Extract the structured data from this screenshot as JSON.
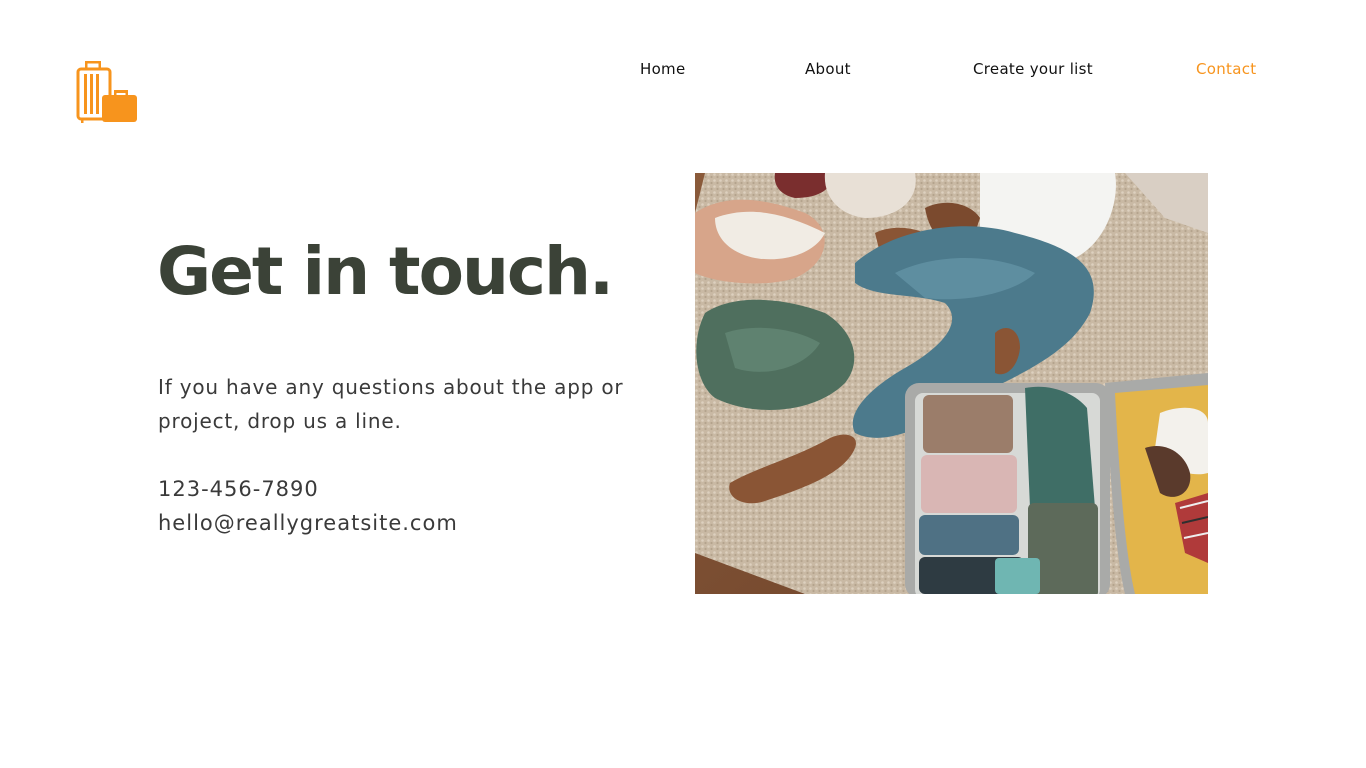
{
  "brand": {
    "logo_icon": "luggage-icon",
    "accent_color": "#F7941D"
  },
  "nav": {
    "items": [
      {
        "label": "Home",
        "active": false
      },
      {
        "label": "About",
        "active": false
      },
      {
        "label": "Create your list",
        "active": false
      },
      {
        "label": "Contact",
        "active": true
      }
    ]
  },
  "hero": {
    "title": "Get in touch.",
    "title_color": "#3B4237",
    "intro": "If you have any questions about the app or project, drop us a line.",
    "phone": "123-456-7890",
    "email": "hello@reallygreatsite.com"
  },
  "photo": {
    "subject": "person-packing-suitcase-photo"
  }
}
